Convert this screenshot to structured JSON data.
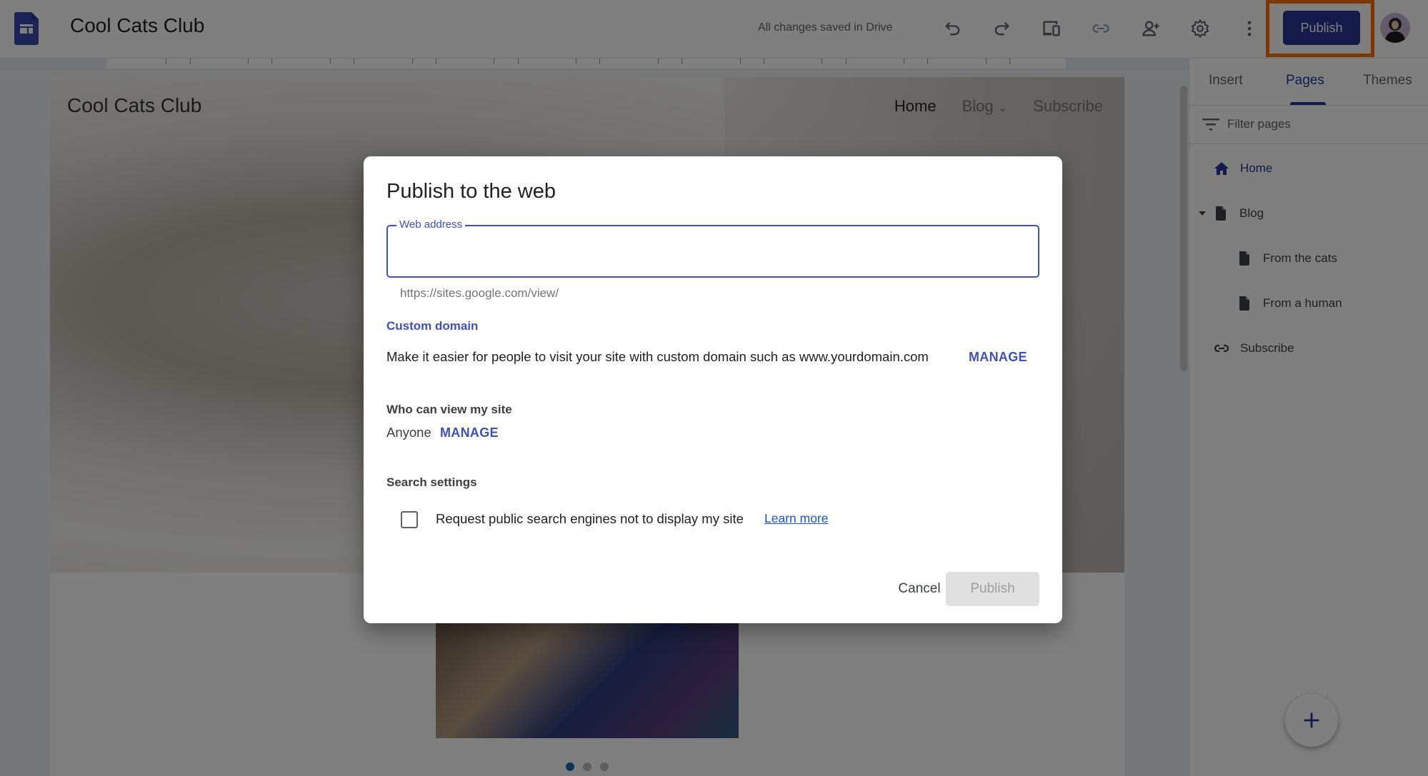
{
  "app": {
    "doc_title": "Cool Cats Club",
    "save_status": "All changes saved in Drive",
    "publish_label": "Publish",
    "toolbar_icons": [
      "undo-icon",
      "redo-icon",
      "preview-devices-icon",
      "link-icon",
      "share-icon",
      "settings-icon",
      "more-vert-icon"
    ],
    "accent_color": "#283593",
    "highlight_color": "#ff6d00"
  },
  "site": {
    "title": "Cool Cats Club",
    "nav": [
      {
        "label": "Home",
        "active": true
      },
      {
        "label": "Blog",
        "has_dropdown": true
      },
      {
        "label": "Subscribe"
      }
    ],
    "carousel": {
      "count": 3,
      "active_index": 0
    }
  },
  "panel": {
    "tabs": [
      {
        "label": "Insert"
      },
      {
        "label": "Pages",
        "active": true
      },
      {
        "label": "Themes"
      }
    ],
    "filter_label": "Filter pages",
    "pages": [
      {
        "label": "Home",
        "icon": "home-icon",
        "level": 0,
        "active": true
      },
      {
        "label": "Blog",
        "icon": "page-icon",
        "level": 0,
        "expanded": true
      },
      {
        "label": "From the cats",
        "icon": "page-icon",
        "level": 1
      },
      {
        "label": "From a human",
        "icon": "page-icon",
        "level": 1
      },
      {
        "label": "Subscribe",
        "icon": "link-icon",
        "level": 0
      }
    ],
    "fab_icon": "add-icon"
  },
  "dialog": {
    "title": "Publish to the web",
    "web_address": {
      "label": "Web address",
      "value": "",
      "hint": "https://sites.google.com/view/"
    },
    "custom_domain": {
      "heading": "Custom domain",
      "text": "Make it easier for people to visit your site with custom domain such as www.yourdomain.com",
      "manage_label": "MANAGE"
    },
    "who_can_view": {
      "heading": "Who can view my site",
      "value": "Anyone",
      "manage_label": "MANAGE"
    },
    "search_settings": {
      "heading": "Search settings",
      "checkbox_label": "Request public search engines not to display my site",
      "checked": false,
      "learn_more": "Learn more"
    },
    "cancel_label": "Cancel",
    "publish_label": "Publish"
  }
}
